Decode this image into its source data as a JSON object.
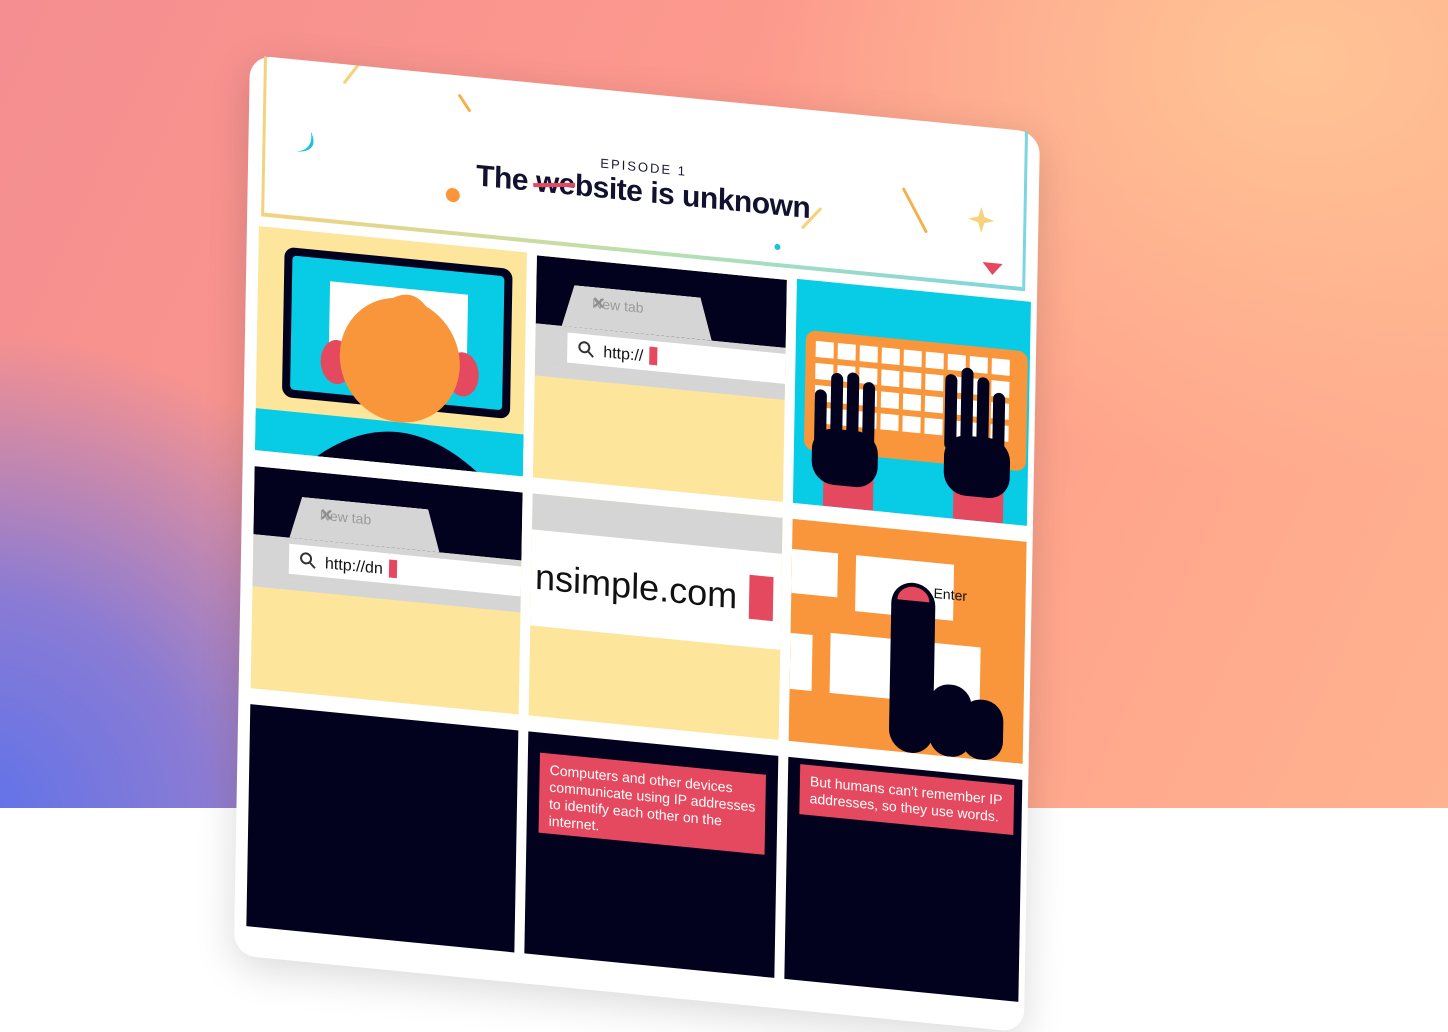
{
  "header": {
    "episode_label": "EPISODE 1",
    "title": "The website is unknown"
  },
  "panels": {
    "browser_1": {
      "tab_label": "New tab",
      "tab_close_glyph": "✕",
      "url_text": "http://"
    },
    "browser_2": {
      "tab_label": "New tab",
      "tab_close_glyph": "✕",
      "url_text": "http://dn"
    },
    "zoom_text": "nsimple.com",
    "enter_key_label": "Enter",
    "caption_1": "Computers and other devices communicate using IP addresses to identify each other on the internet.",
    "caption_2": "But humans can't remember IP addresses, so they use words."
  },
  "icons": [
    "search-icon",
    "close-icon",
    "keyboard",
    "hands",
    "pointing-hand"
  ],
  "colors": {
    "navy": "#02021e",
    "cyan": "#08cce6",
    "yellow": "#fde69b",
    "orange": "#f9953a",
    "red": "#e5495f",
    "gray": "#d5d5d5"
  }
}
